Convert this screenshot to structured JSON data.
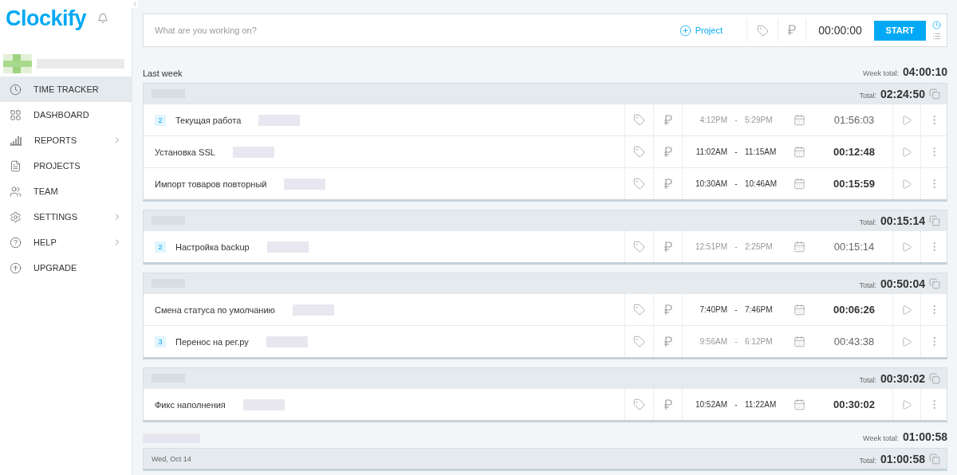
{
  "sidebar": {
    "logo": "Clockify",
    "items": [
      {
        "label": "TIME TRACKER",
        "selected": true,
        "has_submenu": false
      },
      {
        "label": "DASHBOARD",
        "selected": false,
        "has_submenu": false
      },
      {
        "label": "REPORTS",
        "selected": false,
        "has_submenu": true
      },
      {
        "label": "PROJECTS",
        "selected": false,
        "has_submenu": false
      },
      {
        "label": "TEAM",
        "selected": false,
        "has_submenu": false
      },
      {
        "label": "SETTINGS",
        "selected": false,
        "has_submenu": true
      },
      {
        "label": "HELP",
        "selected": false,
        "has_submenu": true
      },
      {
        "label": "UPGRADE",
        "selected": false,
        "has_submenu": false
      }
    ]
  },
  "timer": {
    "placeholder": "What are you working on?",
    "project_label": "Project",
    "time": "00:00:00",
    "start_label": "START"
  },
  "weeks": [
    {
      "label": "Last week",
      "total_label": "Week total:",
      "total": "04:00:10",
      "days": [
        {
          "total_label": "Total:",
          "total": "02:24:50",
          "entries": [
            {
              "count": "2",
              "description": "Текущая работа",
              "start": "4:12PM",
              "separator": "-",
              "end": "5:29PM",
              "duration": "01:56:03"
            },
            {
              "description": "Установка SSL",
              "start": "11:02AM",
              "separator": "-",
              "end": "11:15AM",
              "duration": "00:12:48"
            },
            {
              "description": "Импорт товаров повторный",
              "start": "10:30AM",
              "separator": "-",
              "end": "10:46AM",
              "duration": "00:15:59"
            }
          ]
        },
        {
          "total_label": "Total:",
          "total": "00:15:14",
          "entries": [
            {
              "count": "2",
              "description": "Настройка backup",
              "start": "12:51PM",
              "separator": "-",
              "end": "2:25PM",
              "duration": "00:15:14"
            }
          ]
        },
        {
          "total_label": "Total:",
          "total": "00:50:04",
          "entries": [
            {
              "description": "Смена статуса по умолчанию",
              "start": "7:40PM",
              "separator": "-",
              "end": "7:46PM",
              "duration": "00:06:26"
            },
            {
              "count": "3",
              "description": "Перенос на рег.ру",
              "start": "9:56AM",
              "separator": "-",
              "end": "6:12PM",
              "duration": "00:43:38"
            }
          ]
        },
        {
          "total_label": "Total:",
          "total": "00:30:02",
          "entries": [
            {
              "description": "Фикс наполнения",
              "start": "10:52AM",
              "separator": "-",
              "end": "11:22AM",
              "duration": "00:30:02"
            }
          ]
        }
      ]
    },
    {
      "total_label": "Week total:",
      "total": "01:00:58",
      "days": [
        {
          "date": "Wed, Oct 14",
          "total_label": "Total:",
          "total": "01:00:58"
        }
      ]
    }
  ]
}
